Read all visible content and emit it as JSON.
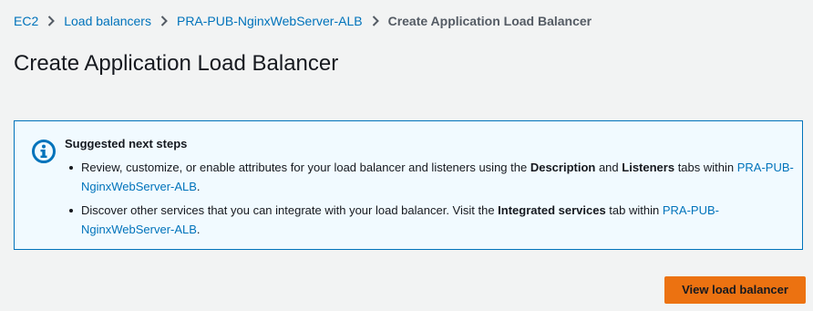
{
  "breadcrumb": {
    "items": [
      {
        "label": "EC2"
      },
      {
        "label": "Load balancers"
      },
      {
        "label": "PRA-PUB-NginxWebServer-ALB"
      },
      {
        "label": "Create Application Load Balancer"
      }
    ]
  },
  "page": {
    "title": "Create Application Load Balancer"
  },
  "alert": {
    "icon": "info-icon",
    "title": "Suggested next steps",
    "items": [
      {
        "t1": "Review, customize, or enable attributes for your load balancer and listeners using the ",
        "b1": "Description",
        "t2": " and ",
        "b2": "Listeners",
        "t3": " tabs within ",
        "link": "PRA-PUB-NginxWebServer-ALB",
        "t4": "."
      },
      {
        "t1": "Discover other services that you can integrate with your load balancer. Visit the ",
        "b1": "Integrated services",
        "t2": " tab within ",
        "link": "PRA-PUB-NginxWebServer-ALB",
        "t3": "."
      }
    ]
  },
  "actions": {
    "view_label": "View load balancer"
  },
  "colors": {
    "background": "#f2f3f3",
    "link": "#0073bb",
    "alert_border": "#0073bb",
    "alert_background": "#f1faff",
    "primary_button": "#ec7211"
  }
}
